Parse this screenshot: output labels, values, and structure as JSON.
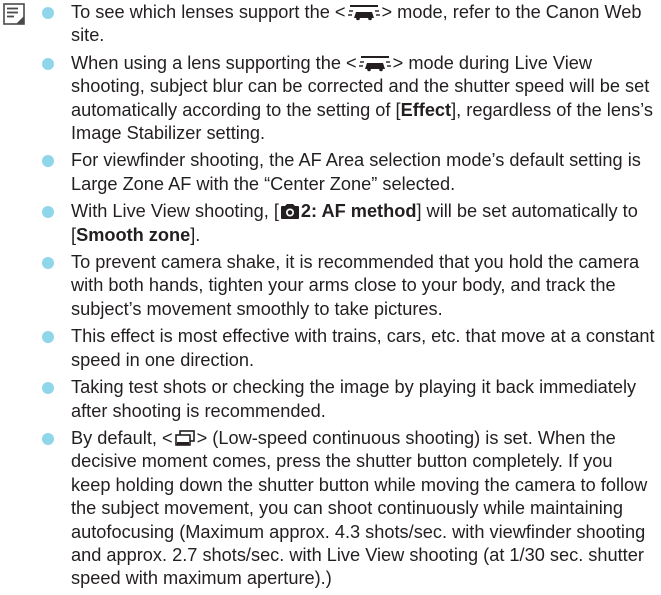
{
  "icons": {
    "note": "note-icon",
    "panning_mode": "panning-mode-icon",
    "shooting_tab": "camera-shooting-tab-icon",
    "low_speed_continuous": "low-speed-continuous-icon"
  },
  "colors": {
    "bullet": "#8fd6ea",
    "text": "#231f20"
  },
  "notes": [
    {
      "t1": "To see which lenses support the <",
      "t2": "> mode, refer to the Canon Web site."
    },
    {
      "t1": "When using a lens supporting the <",
      "t2": "> mode during Live View shooting, subject blur can be corrected and the shutter speed will be set automatically according to the setting of [",
      "b1": "Effect",
      "t3": "], regardless of the lens’s Image Stabilizer setting."
    },
    {
      "t1": "For viewfinder shooting, the AF Area selection mode’s default setting is Large Zone AF with the “Center Zone” selected."
    },
    {
      "t1": "With Live View shooting, [",
      "b1": "2: AF method",
      "t2": "] will be set automatically to [",
      "b2": "Smooth zone",
      "t3": "]."
    },
    {
      "t1": "To prevent camera shake, it is recommended that you hold the camera with both hands, tighten your arms close to your body, and track the subject’s movement smoothly to take pictures."
    },
    {
      "t1": "This effect is most effective with trains, cars, etc. that move at a constant speed in one direction."
    },
    {
      "t1": "Taking test shots or checking the image by playing it back immediately after shooting is recommended."
    },
    {
      "t1": "By default, <",
      "t2": "> (Low-speed continuous shooting) is set. When the decisive moment comes, press the shutter button completely. If you keep holding down the shutter button while moving the camera to follow the subject movement, you can shoot continuously while maintaining autofocusing (Maximum approx. 4.3 shots/sec. with viewfinder shooting and approx. 2.7 shots/sec. with Live View shooting (at 1/30 sec. shutter speed with maximum aperture).)"
    }
  ]
}
